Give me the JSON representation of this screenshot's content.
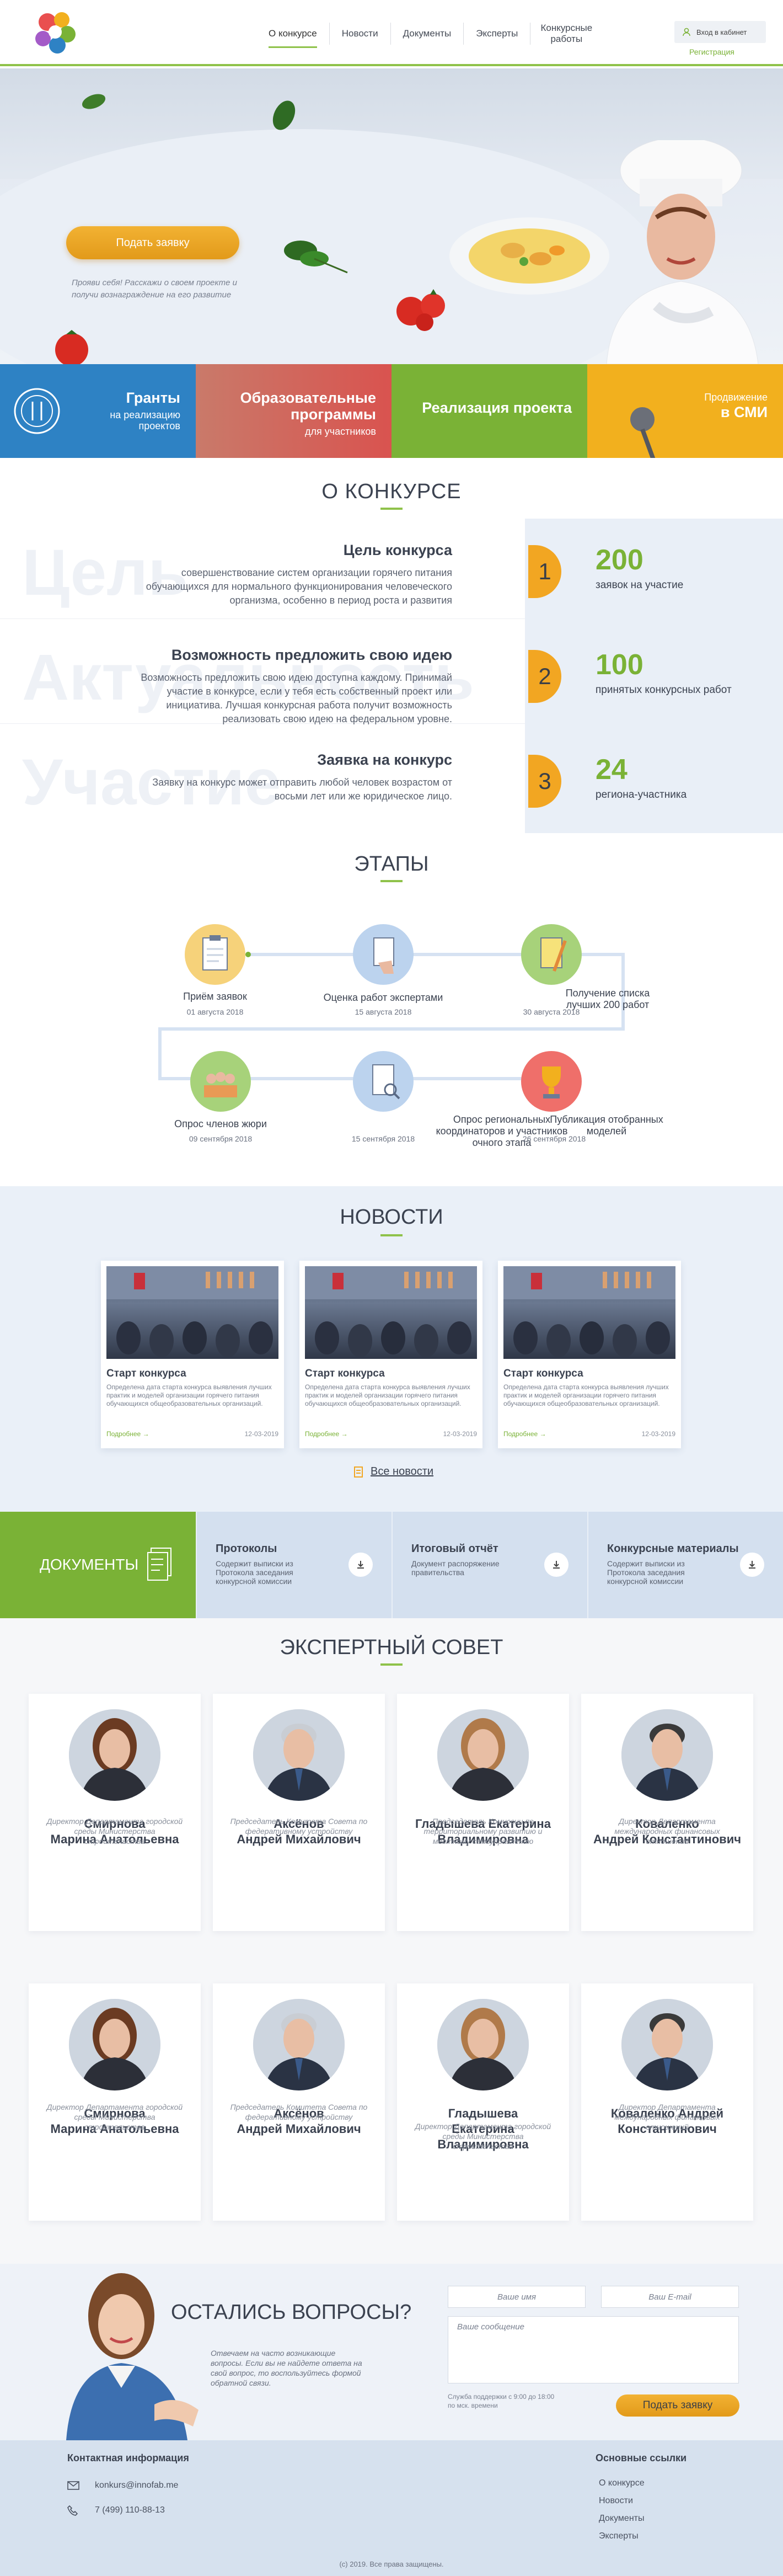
{
  "header": {
    "nav": [
      "О конкурсе",
      "Новости",
      "Документы",
      "Эксперты",
      "Конкурсные работы"
    ],
    "login": "Вход в кабинет",
    "register": "Регистрация"
  },
  "hero": {
    "apply": "Подать заявку",
    "note": "Прояви себя! Расскажи о своем проекте и получи вознаграждение на его развитие"
  },
  "tiles": [
    {
      "title": "Гранты",
      "sub": "на реализацию проектов",
      "color": "#2e82c4"
    },
    {
      "title": "Образовательные программы",
      "sub": "для участников",
      "color": "#d9534f"
    },
    {
      "title": "Реализация проекта",
      "sub": "",
      "color": "#7ab236"
    },
    {
      "title": "Продвижение",
      "title2": "в СМИ",
      "color": "#f2b01e"
    }
  ],
  "about": {
    "title": "О КОНКУРСЕ",
    "rows": [
      {
        "ghost": "Цель",
        "heading": "Цель конкурса",
        "text": "совершенствование систем организации горячего питания обучающихся для нормального функционирования человеческого организма, особенно в период роста и развития",
        "num": "1",
        "stat": "200",
        "stat_label": "заявок на участие"
      },
      {
        "ghost": "Актуальность",
        "heading": "Возможность предложить свою идею",
        "text": "Возможность предложить свою идею доступна каждому. Принимай участие в конкурсе, если у тебя есть собственный проект или инициатива. Лучшая конкурсная работа получит возможность реализовать свою идею на федеральном уровне.",
        "num": "2",
        "stat": "100",
        "stat_label": "принятых конкурсных работ"
      },
      {
        "ghost": "Участие",
        "heading": "Заявка на конкурс",
        "text": "Заявку на конкурс может отправить любой человек возрастом от восьми лет или же юридическое лицо.",
        "num": "3",
        "stat": "24",
        "stat_label": "региона-участника"
      }
    ]
  },
  "stages": {
    "title": "ЭТАПЫ",
    "items": [
      {
        "name": "Приём заявок",
        "date": "01 августа 2018"
      },
      {
        "name": "Оценка работ экспертами",
        "date": "15 августа 2018"
      },
      {
        "name": "Получение списка лучших 200 работ",
        "date": "30 августа 2018"
      },
      {
        "name": "Опрос членов жюри",
        "date": "09 сентября 2018"
      },
      {
        "name": "",
        "date": "15 сентября 2018"
      },
      {
        "name": "Опрос региональных координаторов и участников очного этапа",
        "name2": "Публикация отобранных моделей",
        "date": "26 сентября 2018"
      }
    ]
  },
  "news": {
    "title": "НОВОСТИ",
    "cards": [
      {
        "title": "Старт  конкурса",
        "text": "Определена дата старта конкурса выявления лучших практик и  моделей  организации горячего питания обучающихся общеобразовательных организаций.",
        "more": "Подробнее",
        "date": "12-03-2019"
      },
      {
        "title": "Старт  конкурса",
        "text": "Определена дата старта конкурса выявления лучших практик и  моделей  организации горячего питания обучающихся общеобразовательных организаций.",
        "more": "Подробнее",
        "date": "12-03-2019"
      },
      {
        "title": "Старт  конкурса",
        "text": "Определена дата старта конкурса выявления лучших практик и  моделей  организации горячего питания обучающихся общеобразовательных организаций.",
        "more": "Подробнее",
        "date": "12-03-2019"
      }
    ],
    "all": "Все новости"
  },
  "docs": {
    "title": "ДОКУМЕНТЫ",
    "items": [
      {
        "h": "Протоколы",
        "p": "Содержит выписки из Протокола заседания конкурсной комиссии"
      },
      {
        "h": "Итоговый отчёт",
        "p": "Документ распоряжение правительства"
      },
      {
        "h": "Конкурсные материалы",
        "p": "Содержит выписки из Протокола заседания конкурсной комиссии"
      }
    ]
  },
  "experts": {
    "title": "ЭКСПЕРТНЫЙ СОВЕТ",
    "items": [
      {
        "name": "Смирнова\nМарина Анатольевна",
        "pos": "Директор Департамента городской среды Министерства строительства"
      },
      {
        "name": "Аксёнов\nАндрей Михайлович",
        "pos": "Председатель Комитета Совета по федеративному устройству"
      },
      {
        "name": "Гладышева Екатерина Владимировна",
        "pos": "Председатель Комиссии по территориальному развитию и местному самоуправлению"
      },
      {
        "name": "Коваленко\nАндрей Константинович",
        "pos": "Директор Департамента международных финансовых отношений"
      },
      {
        "name": "Смирнова\nМарина Анатольевна",
        "pos": "Директор Департамента городской среды Министерства строительства"
      },
      {
        "name": "Аксёнов\nАндрей Михайлович",
        "pos": "Председатель Комитета Совета по федеративному устройству"
      },
      {
        "name": "Гладышева\nЕкатерина\nВладимировна",
        "pos": "Директор Департамента городской среды Министерства строительства"
      },
      {
        "name": "Коваленко Андрей Константинович",
        "pos": "Директор Департамента международных финансовых отношений"
      }
    ]
  },
  "questions": {
    "title": "ОСТАЛИСЬ ВОПРОСЫ?",
    "text": "Отвечаем на часто возникающие вопросы. Если вы не найдете ответа на свой вопрос, то воспользуйтесь формой обратной связи.",
    "name_ph": "Ваше имя",
    "email_ph": "Ваш E-mail",
    "msg_ph": "Ваше сообщение",
    "support": "Служба поддержки с 9:00 до 18:00 по мск. времени",
    "send": "Подать заявку"
  },
  "footer": {
    "contact_title": "Контактная информация",
    "email": "konkurs@innofab.me",
    "phone": "7 (499) 110-88-13",
    "links_title": "Основные ссылки",
    "links": [
      "О конкурсе",
      "Новости",
      "Документы",
      "Эксперты"
    ],
    "copy": "(с) 2019. Все права защищены."
  }
}
